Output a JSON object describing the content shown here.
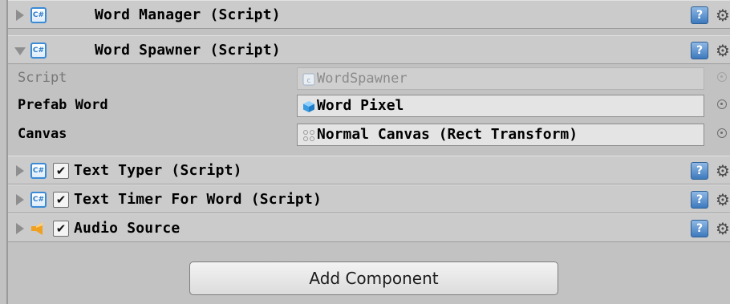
{
  "components": [
    {
      "title": "Word Manager (Script)",
      "expanded": false,
      "has_checkbox": false,
      "icon": "csharp-script-icon"
    },
    {
      "title": "Word Spawner (Script)",
      "expanded": true,
      "has_checkbox": false,
      "icon": "csharp-script-icon",
      "properties": [
        {
          "label": "Script",
          "value": "WordSpawner",
          "icon": "script-asset-icon",
          "disabled": true
        },
        {
          "label": "Prefab Word",
          "value": "Word Pixel",
          "icon": "prefab-cube-icon",
          "disabled": false
        },
        {
          "label": "Canvas",
          "value": "Normal Canvas (Rect Transform)",
          "icon": "rect-transform-icon",
          "disabled": false
        }
      ]
    },
    {
      "title": "Text Typer (Script)",
      "expanded": false,
      "has_checkbox": true,
      "checked": true,
      "icon": "csharp-script-icon"
    },
    {
      "title": "Text Timer For Word (Script)",
      "expanded": false,
      "has_checkbox": true,
      "checked": true,
      "icon": "csharp-script-icon"
    },
    {
      "title": "Audio Source",
      "expanded": false,
      "has_checkbox": true,
      "checked": true,
      "icon": "audio-source-icon"
    }
  ],
  "icons": {
    "cs_glyph": "C#",
    "help_glyph": "?",
    "gear_glyph": "⚙",
    "check_glyph": "✔"
  },
  "add_component_label": "Add Component",
  "colors": {
    "panel_background": "#c2c2c2",
    "header_background": "#cbcbcb",
    "script_icon_blue": "#3b8ad6",
    "audio_icon_orange": "#f0a020"
  }
}
